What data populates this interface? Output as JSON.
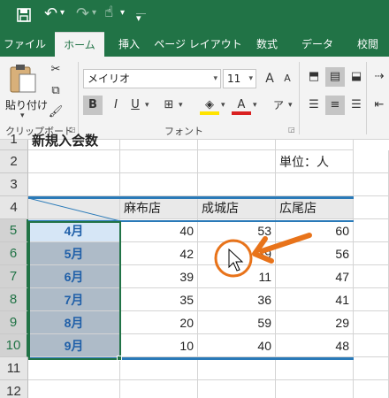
{
  "qat": {
    "undo": "↶",
    "redo": "↷",
    "touch": "☝",
    "more": "▾"
  },
  "tabs": [
    {
      "label": "ファイル"
    },
    {
      "label": "ホーム"
    },
    {
      "label": "挿入"
    },
    {
      "label": "ページ レイアウト"
    },
    {
      "label": "数式"
    },
    {
      "label": "データ"
    },
    {
      "label": "校閲"
    }
  ],
  "ribbon": {
    "paste_label": "貼り付け",
    "clipboard_label": "クリップボード",
    "font_group_label": "フォント",
    "font_name": "メイリオ",
    "font_size": "11",
    "grow_font": "A",
    "shrink_font": "A",
    "bold": "B",
    "italic": "I",
    "underline": "U",
    "font_color_letter": "A"
  },
  "rows": [
    {
      "num": "1",
      "a": "",
      "b": "新規入会数",
      "c": "",
      "d": "",
      "e": ""
    },
    {
      "num": "2",
      "a": "",
      "b": "",
      "c": "",
      "d": "単位：人",
      "e": ""
    },
    {
      "num": "3",
      "a": "",
      "b": "",
      "c": "",
      "d": "",
      "e": ""
    },
    {
      "num": "4",
      "a": "",
      "b": "麻布店",
      "c": "成城店",
      "d": "広尾店",
      "e": ""
    },
    {
      "num": "5",
      "a": "4月",
      "b": "40",
      "c": "53",
      "d": "60"
    },
    {
      "num": "6",
      "a": "5月",
      "b": "42",
      "c": "39",
      "d": "56"
    },
    {
      "num": "7",
      "a": "6月",
      "b": "39",
      "c": "11",
      "d": "47"
    },
    {
      "num": "8",
      "a": "7月",
      "b": "35",
      "c": "36",
      "d": "41"
    },
    {
      "num": "9",
      "a": "8月",
      "b": "20",
      "c": "59",
      "d": "29"
    },
    {
      "num": "10",
      "a": "9月",
      "b": "10",
      "c": "40",
      "d": "48"
    },
    {
      "num": "11"
    },
    {
      "num": "12"
    }
  ],
  "colors": {
    "excel_green": "#217346",
    "annotation_orange": "#e8731a",
    "table_border": "#2a7ab8",
    "selection_fill": "#aebbc8"
  }
}
